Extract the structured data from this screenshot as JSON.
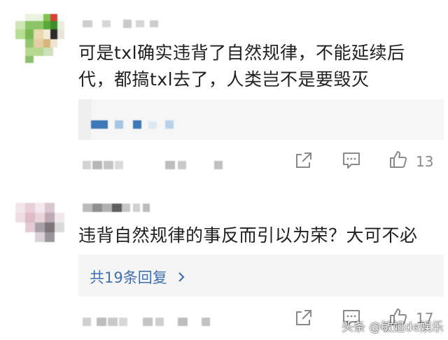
{
  "comments": [
    {
      "text_line1": "可是txl确实违背了自然规律，不能延续后",
      "text_line2": "代，都搞txl去了，人类岂不是要毁灭",
      "likes": "13"
    },
    {
      "text": "违背自然规律的事反而引以为荣？大可不必",
      "reply_link": "共19条回复",
      "likes": "17"
    }
  ],
  "icons": {
    "share": "share-icon",
    "comment": "comment-icon",
    "like": "thumbs-up-icon",
    "chevron": "chevron-right-icon"
  },
  "colors": {
    "accent": "#3f6fb0",
    "muted": "#8a8a8a",
    "panel": "#f5f5f5"
  },
  "watermark": "头条 @敏姐de娱乐"
}
